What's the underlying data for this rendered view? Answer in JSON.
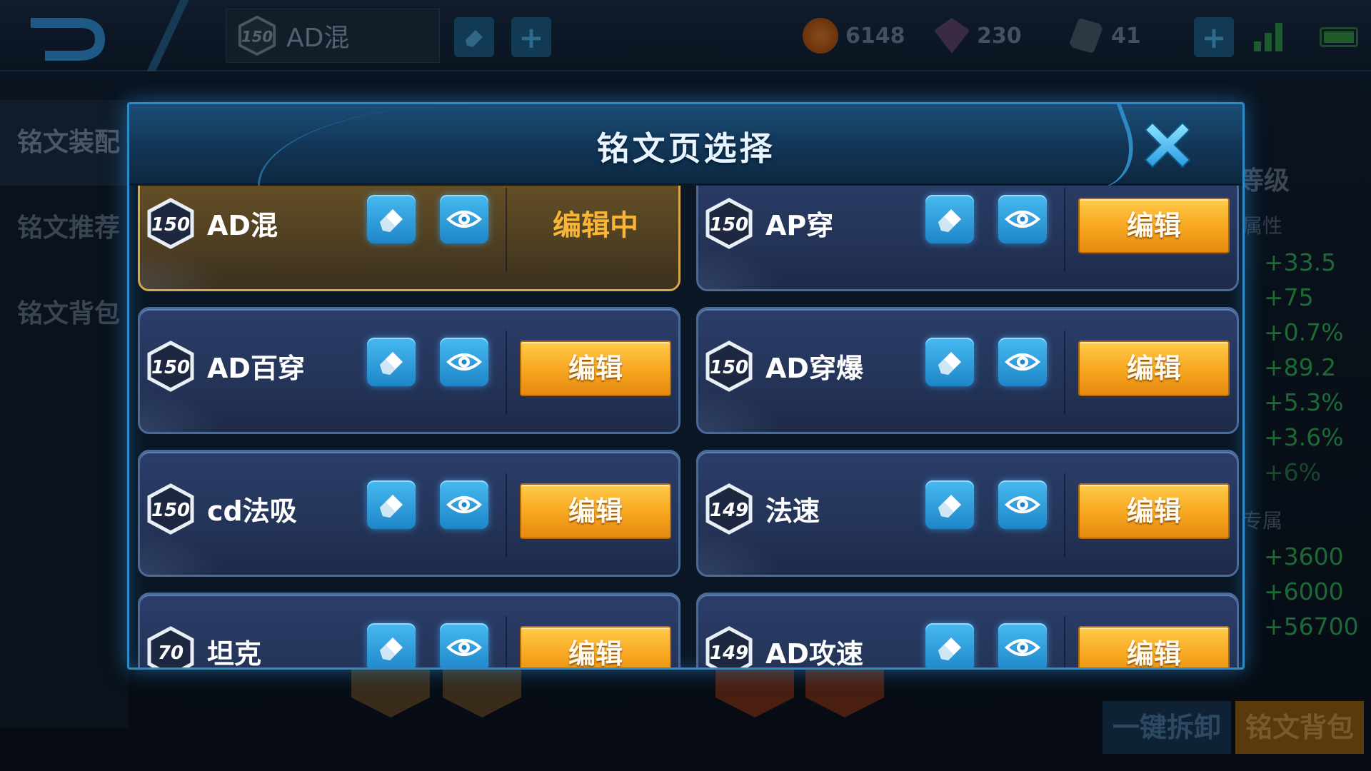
{
  "topbar": {
    "current_page": {
      "level": "150",
      "name": "AD混"
    },
    "currencies": [
      {
        "icon": "gold-coin-icon",
        "value": "6148"
      },
      {
        "icon": "diamond-icon",
        "value": "230"
      },
      {
        "icon": "crystal-icon",
        "value": "41"
      }
    ]
  },
  "sidebar": {
    "items": [
      {
        "label": "铭文装配"
      },
      {
        "label": "铭文推荐"
      },
      {
        "label": "铭文背包"
      }
    ]
  },
  "right_panel": {
    "title": "等级",
    "attr_heading": "属性",
    "attr_values": [
      "+33.5",
      "+75",
      "+0.7%",
      "+89.2",
      "+5.3%",
      "+3.6%",
      "+6%"
    ],
    "exclusive_heading": "专属",
    "exclusive_values": [
      "+3600",
      "+6000",
      "+56700"
    ]
  },
  "bottom": {
    "unequip_all_label": "一键拆卸",
    "bag_label": "铭文背包"
  },
  "modal": {
    "title": "铭文页选择",
    "editing_label": "编辑中",
    "edit_label": "编辑",
    "pages": [
      {
        "level": "150",
        "name": "AD混",
        "active": true
      },
      {
        "level": "150",
        "name": "AP穿",
        "active": false
      },
      {
        "level": "150",
        "name": "AD百穿",
        "active": false
      },
      {
        "level": "150",
        "name": "AD穿爆",
        "active": false
      },
      {
        "level": "150",
        "name": "cd法吸",
        "active": false
      },
      {
        "level": "149",
        "name": "法速",
        "active": false
      },
      {
        "level": "70",
        "name": "坦克",
        "active": false
      },
      {
        "level": "149",
        "name": "AD攻速",
        "active": false
      }
    ]
  },
  "colors": {
    "accent_blue": "#2d8cc8",
    "edit_orange": "#f7a51e",
    "active_gold": "#d6a94a",
    "stat_green": "#1d6a36"
  }
}
